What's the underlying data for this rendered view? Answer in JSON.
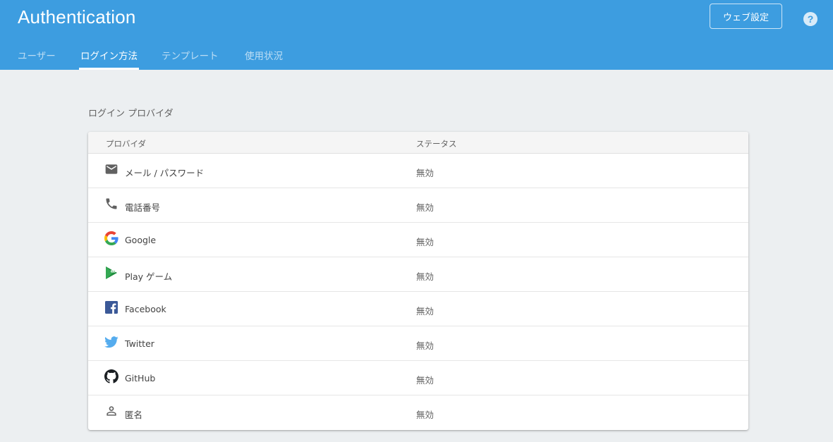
{
  "header": {
    "title": "Authentication",
    "web_setup_label": "ウェブ設定",
    "help_label": "?",
    "tabs": [
      {
        "label": "ユーザー"
      },
      {
        "label": "ログイン方法"
      },
      {
        "label": "テンプレート"
      },
      {
        "label": "使用状況"
      }
    ],
    "active_tab": "ログイン方法",
    "accent_color": "#3d9de0"
  },
  "main": {
    "section_title": "ログイン プロバイダ",
    "columns": {
      "provider": "プロバイダ",
      "status": "ステータス"
    },
    "providers": [
      {
        "name": "メール / パスワード",
        "status": "無効",
        "icon": "email-icon"
      },
      {
        "name": "電話番号",
        "status": "無効",
        "icon": "phone-icon"
      },
      {
        "name": "Google",
        "status": "無効",
        "icon": "google-icon"
      },
      {
        "name": "Play ゲーム",
        "status": "無効",
        "icon": "play-games-icon"
      },
      {
        "name": "Facebook",
        "status": "無効",
        "icon": "facebook-icon"
      },
      {
        "name": "Twitter",
        "status": "無効",
        "icon": "twitter-icon"
      },
      {
        "name": "GitHub",
        "status": "無効",
        "icon": "github-icon"
      },
      {
        "name": "匿名",
        "status": "無効",
        "icon": "anonymous-icon"
      }
    ]
  }
}
